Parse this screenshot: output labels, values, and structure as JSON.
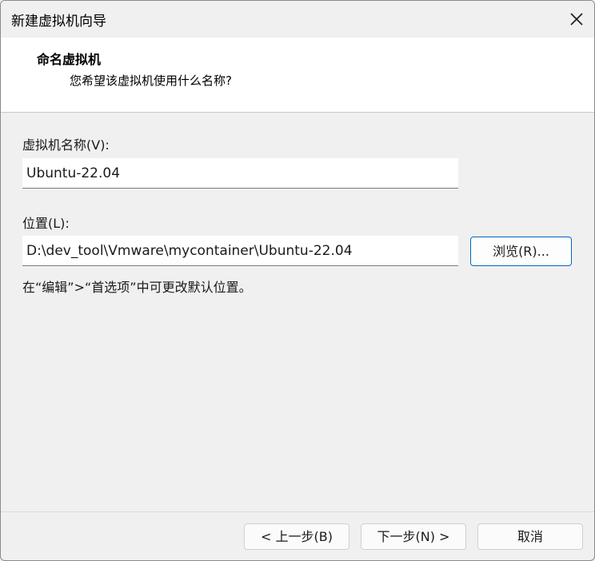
{
  "window": {
    "title": "新建虚拟机向导"
  },
  "header": {
    "title": "命名虚拟机",
    "subtitle": "您希望该虚拟机使用什么名称?"
  },
  "form": {
    "name_label": "虚拟机名称(V):",
    "name_value": "Ubuntu-22.04",
    "location_label": "位置(L):",
    "location_value": "D:\\dev_tool\\Vmware\\mycontainer\\Ubuntu-22.04",
    "browse_label": "浏览(R)...",
    "hint": "在“编辑”>“首选项”中可更改默认位置。"
  },
  "footer": {
    "back_label": "< 上一步(B)",
    "next_label": "下一步(N) >",
    "cancel_label": "取消"
  },
  "colors": {
    "accent": "#0067c0",
    "background": "#f0f0f0",
    "header_background": "#ffffff"
  },
  "icons": {
    "close": "close-icon"
  }
}
